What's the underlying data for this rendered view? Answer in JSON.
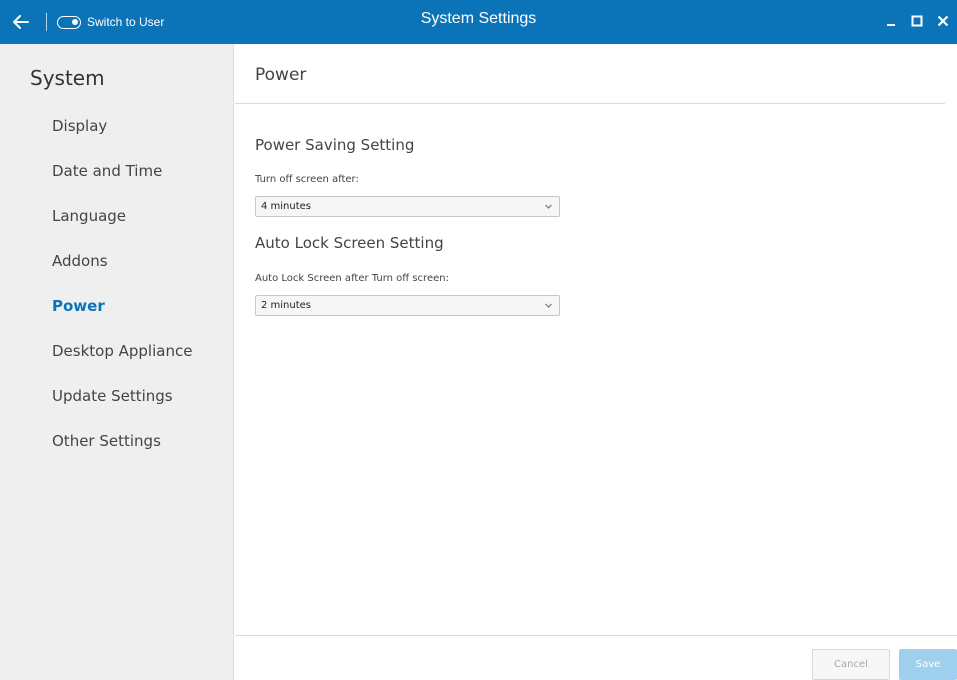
{
  "titlebar": {
    "switch_label": "Switch to User",
    "title": "System Settings",
    "icons": [
      "back-arrow-icon",
      "toggle-icon",
      "minimize-icon",
      "maximize-icon",
      "close-icon"
    ],
    "background_color": "#0b74b9"
  },
  "sidebar": {
    "title": "System",
    "items": [
      {
        "label": "Display",
        "active": false
      },
      {
        "label": "Date and Time",
        "active": false
      },
      {
        "label": "Language",
        "active": false
      },
      {
        "label": "Addons",
        "active": false
      },
      {
        "label": "Power",
        "active": true
      },
      {
        "label": "Desktop Appliance",
        "active": false
      },
      {
        "label": "Update Settings",
        "active": false
      },
      {
        "label": "Other Settings",
        "active": false
      }
    ],
    "active_color": "#0b74b9"
  },
  "main": {
    "title": "Power",
    "power_saving": {
      "section_title": "Power Saving Setting",
      "label": "Turn off screen after:",
      "value": "4 minutes"
    },
    "auto_lock": {
      "section_title": "Auto Lock Screen Setting",
      "label": "Auto Lock Screen after Turn off screen:",
      "value": "2 minutes"
    }
  },
  "footer": {
    "cancel_label": "Cancel",
    "save_label": "Save"
  }
}
